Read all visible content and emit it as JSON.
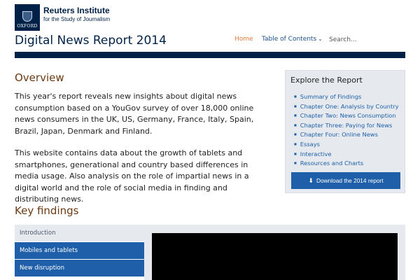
{
  "logo": {
    "crest_text": "OXFORD",
    "title": "Reuters Institute",
    "subtitle": "for the Study of Journalism"
  },
  "site_title": "Digital News Report 2014",
  "nav": {
    "home": "Home",
    "toc": "Table of Contents",
    "search_placeholder": "Search..."
  },
  "overview": {
    "heading": "Overview",
    "paragraphs": [
      "This year's report reveals new insights about digital news consumption based on a YouGov survey of over 18,000 online news consumers in the UK, US, Germany, France, Italy, Spain, Brazil, Japan, Denmark and Finland.",
      "This website contains data about the growth of tablets and smartphones, generational and country based differences in media usage. Also analysis on the role of impartial news in a digital world and the role of social media in finding and distributing news."
    ]
  },
  "explore": {
    "heading": "Explore the Report",
    "items": [
      "Summary of Findings",
      "Chapter One: Analysis by Country",
      "Chapter Two: News Consumption",
      "Chapter Three: Paying for News",
      "Chapter Four: Online News",
      "Essays",
      "Interactive",
      "Resources and Charts"
    ],
    "download_label": "Download the 2014 report"
  },
  "key_findings": {
    "heading": "Key findings",
    "tabs": [
      "Introduction",
      "Mobiles and tablets",
      "New disruption"
    ],
    "active_tab": "Introduction"
  },
  "colors": {
    "navy": "#002147",
    "link_blue": "#1f5fa9",
    "heading_brown": "#6b3a12",
    "home_orange": "#e07b39",
    "panel_gray": "#e6e9ee"
  }
}
